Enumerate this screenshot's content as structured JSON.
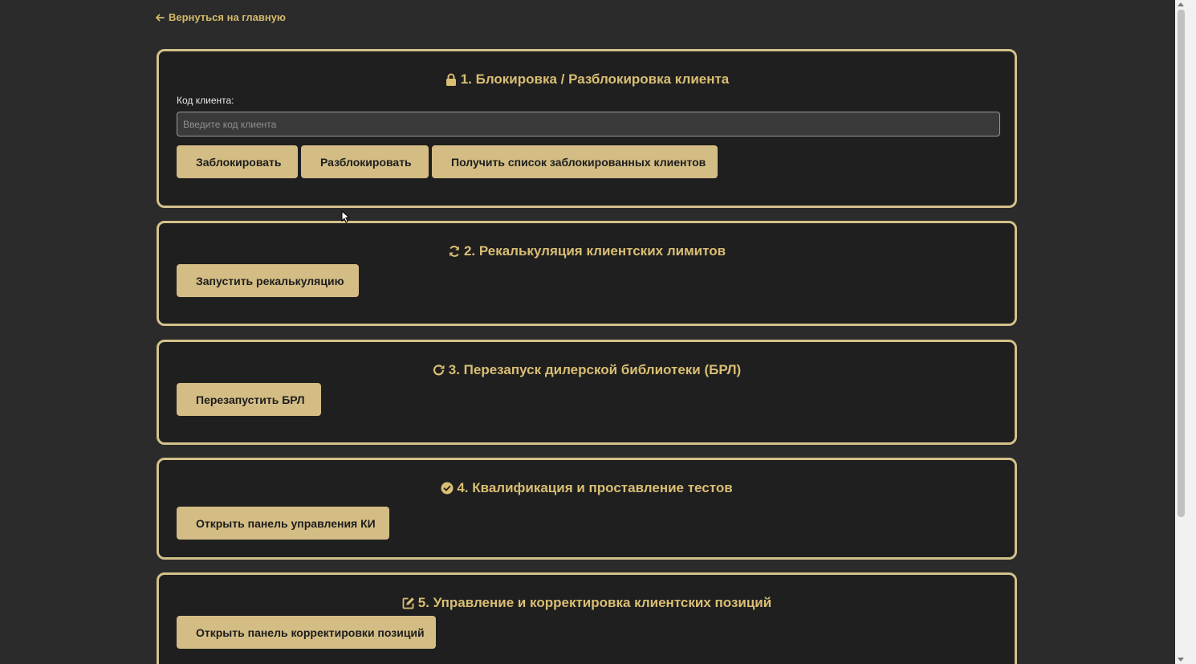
{
  "nav": {
    "back_label": "Вернуться на главную"
  },
  "sections": {
    "block": {
      "title": "1. Блокировка / Разблокировка клиента",
      "icon": "lock-icon",
      "field_label": "Код клиента:",
      "field_placeholder": "Введите код клиента",
      "field_value": "",
      "buttons": {
        "block": "Заблокировать",
        "unblock": "Разблокировать",
        "list": "Получить список заблокированных клиентов"
      }
    },
    "recalc": {
      "title": "2. Рекалькуляция клиентских лимитов",
      "icon": "sync-icon",
      "button": "Запустить рекалькуляцию"
    },
    "restart": {
      "title": "3. Перезапуск дилерской библиотеки (БРЛ)",
      "icon": "redo-icon",
      "button": "Перезапустить БРЛ"
    },
    "qualify": {
      "title": "4. Квалификация и проставление тестов",
      "icon": "check-circle-icon",
      "button": "Открыть панель управления КИ"
    },
    "positions": {
      "title": "5. Управление и корректировка клиентских позиций",
      "icon": "edit-icon",
      "button": "Открыть панель корректировки позиций"
    }
  },
  "colors": {
    "background": "#2b2b2b",
    "card_background": "#1f1f1f",
    "accent": "#d9be73",
    "button": "#d3bd84",
    "border": "#d4c18a"
  }
}
